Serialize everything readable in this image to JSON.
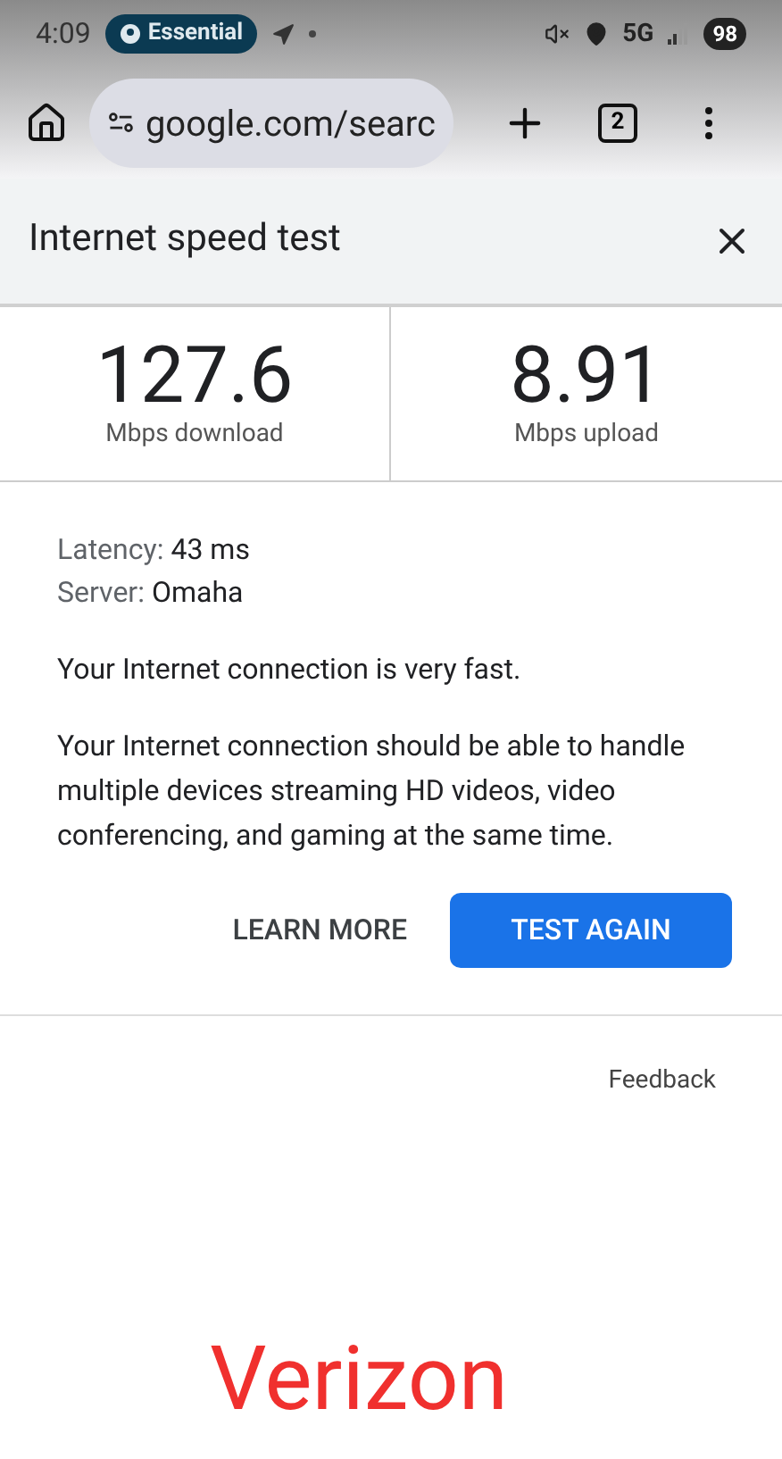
{
  "status_bar": {
    "time": "4:09",
    "pill": "Essential",
    "network": "5G",
    "battery": "98"
  },
  "browser": {
    "url": "google.com/searc",
    "tab_count": "2"
  },
  "card": {
    "title": "Internet speed test",
    "results": [
      {
        "value": "127.6",
        "unit": "Mbps download"
      },
      {
        "value": "8.91",
        "unit": "Mbps upload"
      }
    ],
    "details": [
      {
        "label": "Latency:",
        "value": "43 ms"
      },
      {
        "label": "Server:",
        "value": "Omaha"
      }
    ],
    "paragraphs": [
      "Your Internet connection is very fast.",
      "Your Internet connection should be able to handle multiple devices streaming HD videos, video conferencing, and gaming at the same time."
    ],
    "buttons": [
      {
        "label": "LEARN MORE",
        "kind": "text"
      },
      {
        "label": "TEST AGAIN",
        "kind": "primary"
      }
    ],
    "feedback": "Feedback"
  },
  "footer_text": "Verizon"
}
